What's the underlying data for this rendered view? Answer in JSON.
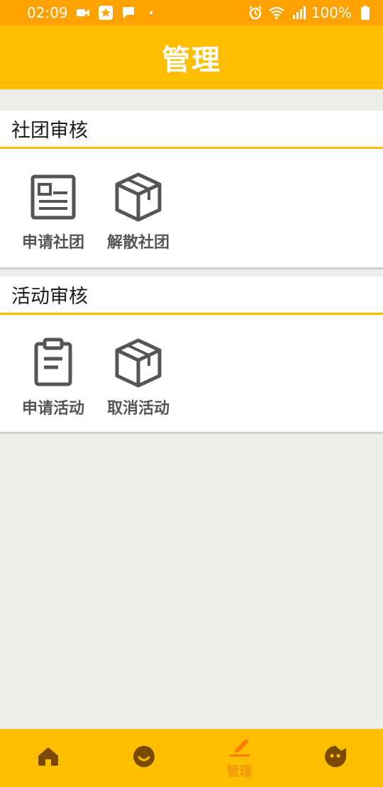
{
  "status_bar": {
    "time": "02:09",
    "battery": "100%",
    "left_icons": [
      "video-camera-icon",
      "app-badge-icon",
      "chat-bubble-icon",
      "dot-icon"
    ],
    "right_icons": [
      "alarm-icon",
      "wifi-icon",
      "signal-icon",
      "battery-icon"
    ]
  },
  "header": {
    "title": "管理"
  },
  "sections": [
    {
      "title": "社团审核",
      "items": [
        {
          "label": "申请社团",
          "icon": "id-card-icon"
        },
        {
          "label": "解散社团",
          "icon": "package-box-icon"
        }
      ]
    },
    {
      "title": "活动审核",
      "items": [
        {
          "label": "申请活动",
          "icon": "clipboard-icon"
        },
        {
          "label": "取消活动",
          "icon": "package-box-icon"
        }
      ]
    }
  ],
  "tabbar": {
    "tabs": [
      {
        "icon": "home-icon",
        "label": ""
      },
      {
        "icon": "smile-face-icon",
        "label": ""
      },
      {
        "icon": "pencil-icon",
        "label": "管理",
        "active": true
      },
      {
        "icon": "profile-face-icon",
        "label": ""
      }
    ]
  },
  "colors": {
    "status_bar": "#ffa200",
    "accent": "#ffbf00",
    "active_tab": "#ff7a00",
    "icon_gray": "#555555",
    "background": "#ededec"
  }
}
